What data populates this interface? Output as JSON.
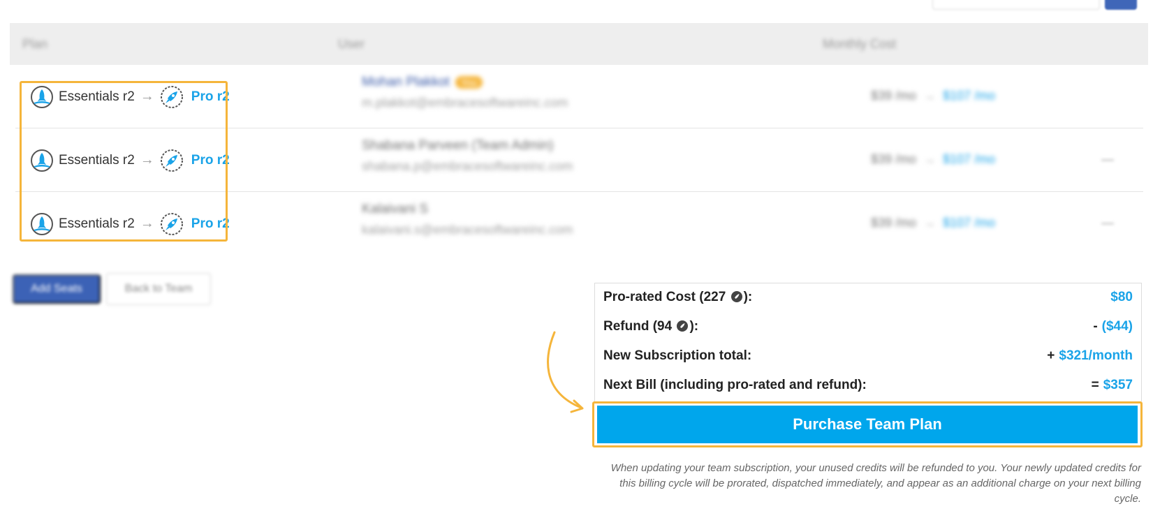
{
  "table": {
    "headers": {
      "plan": "Plan",
      "user": "User",
      "cost": "Monthly Cost"
    },
    "rows": [
      {
        "from_plan": "Essentials r2",
        "to_plan": "Pro r2",
        "user_name": "Mohan Plakkot",
        "badge": "You",
        "email": "m.plakkot@embracesoftwareinc.com",
        "old_cost": "$39 /mo",
        "new_cost": "$107 /mo"
      },
      {
        "from_plan": "Essentials r2",
        "to_plan": "Pro r2",
        "user_name": "Shabana Parveen (Team Admin)",
        "email": "shabana.p@embracesoftwareinc.com",
        "old_cost": "$39 /mo",
        "new_cost": "$107 /mo",
        "more": "—"
      },
      {
        "from_plan": "Essentials r2",
        "to_plan": "Pro r2",
        "user_name": "Kalaivani S",
        "email": "kalaivani.s@embracesoftwareinc.com",
        "old_cost": "$39 /mo",
        "new_cost": "$107 /mo",
        "more": "—"
      }
    ]
  },
  "buttons": {
    "add_seats": "Add Seats",
    "back_to_team": "Back to Team",
    "purchase": "Purchase Team Plan"
  },
  "summary": {
    "prorated_label_pre": "Pro-rated Cost (227",
    "prorated_label_post": "):",
    "prorated_value": "$80",
    "refund_label_pre": "Refund (94",
    "refund_label_post": "):",
    "refund_op": "-",
    "refund_value": "($44)",
    "subtotal_label": "New Subscription total:",
    "subtotal_op": "+",
    "subtotal_value": "$321/month",
    "next_bill_label": "Next Bill (including pro-rated and refund):",
    "next_bill_op": "=",
    "next_bill_value": "$357"
  },
  "note": "When updating your team subscription, your unused credits will be refunded to you. Your newly updated credits for this billing cycle will be prorated, dispatched immediately, and appear as an additional charge on your next billing cycle.",
  "colors": {
    "accent": "#00a6ec",
    "highlight": "#f5b53b",
    "link": "#1aa3e8",
    "nav_blue": "#3c62b6"
  },
  "icons": {
    "essentials": "rocket-badge-icon",
    "pro": "rocket-launch-icon",
    "credit": "credit-icon",
    "arrow": "right-arrow-icon"
  }
}
